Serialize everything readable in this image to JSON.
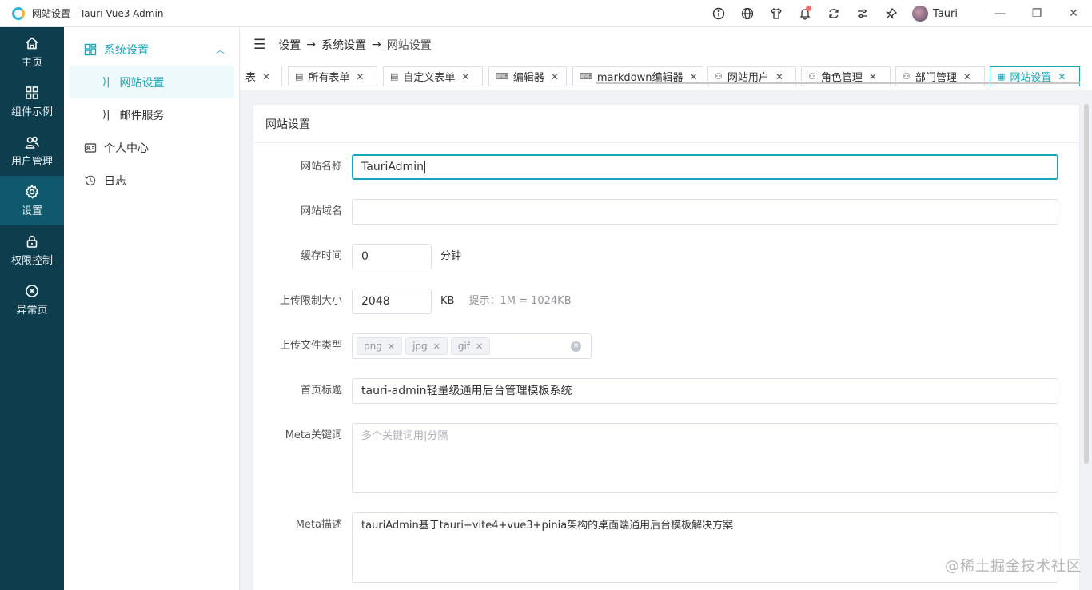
{
  "window": {
    "title": "网站设置 - Tauri Vue3 Admin",
    "user_name": "Tauri",
    "minimize": "—",
    "maximize": "❐",
    "close": "✕"
  },
  "rail": {
    "items": [
      {
        "label": "主页",
        "icon": "home-icon"
      },
      {
        "label": "组件示例",
        "icon": "grid-icon"
      },
      {
        "label": "用户管理",
        "icon": "users-icon"
      },
      {
        "label": "设置",
        "icon": "gear-icon"
      },
      {
        "label": "权限控制",
        "icon": "lock-icon"
      },
      {
        "label": "异常页",
        "icon": "error-icon"
      }
    ]
  },
  "submenu": {
    "group_label": "系统设置",
    "sub_items": [
      "网站设置",
      "邮件服务"
    ],
    "personal_center": "个人中心",
    "log": "日志"
  },
  "breadcrumb": [
    "设置",
    "系统设置",
    "网站设置"
  ],
  "tabs": [
    {
      "label": "表"
    },
    {
      "label": "所有表单"
    },
    {
      "label": "自定义表单"
    },
    {
      "label": "编辑器"
    },
    {
      "label": "markdown编辑器"
    },
    {
      "label": "网站用户"
    },
    {
      "label": "角色管理"
    },
    {
      "label": "部门管理"
    },
    {
      "label": "网站设置"
    }
  ],
  "card_title": "网站设置",
  "form": {
    "site_name": {
      "label": "网站名称",
      "value": "TauriAdmin"
    },
    "site_domain": {
      "label": "网站域名",
      "value": ""
    },
    "cache_time": {
      "label": "缓存时间",
      "value": "0",
      "unit": "分钟"
    },
    "upload_limit": {
      "label": "上传限制大小",
      "value": "2048",
      "unit": "KB",
      "hint": "提示：1M = 1024KB"
    },
    "upload_types": {
      "label": "上传文件类型",
      "tags": [
        "png",
        "jpg",
        "gif"
      ]
    },
    "home_title": {
      "label": "首页标题",
      "value": "tauri-admin轻量级通用后台管理模板系统"
    },
    "meta_keywords": {
      "label": "Meta关键词",
      "placeholder": "多个关键词用|分隔"
    },
    "meta_desc": {
      "label": "Meta描述",
      "value": "tauriAdmin基于tauri+vite4+vue3+pinia架构的桌面端通用后台模板解决方案"
    }
  },
  "watermark": "@稀土掘金技术社区",
  "colors": {
    "accent": "#18a5b7",
    "rail_bg": "#0e3d4d",
    "rail_active": "#10596d"
  }
}
